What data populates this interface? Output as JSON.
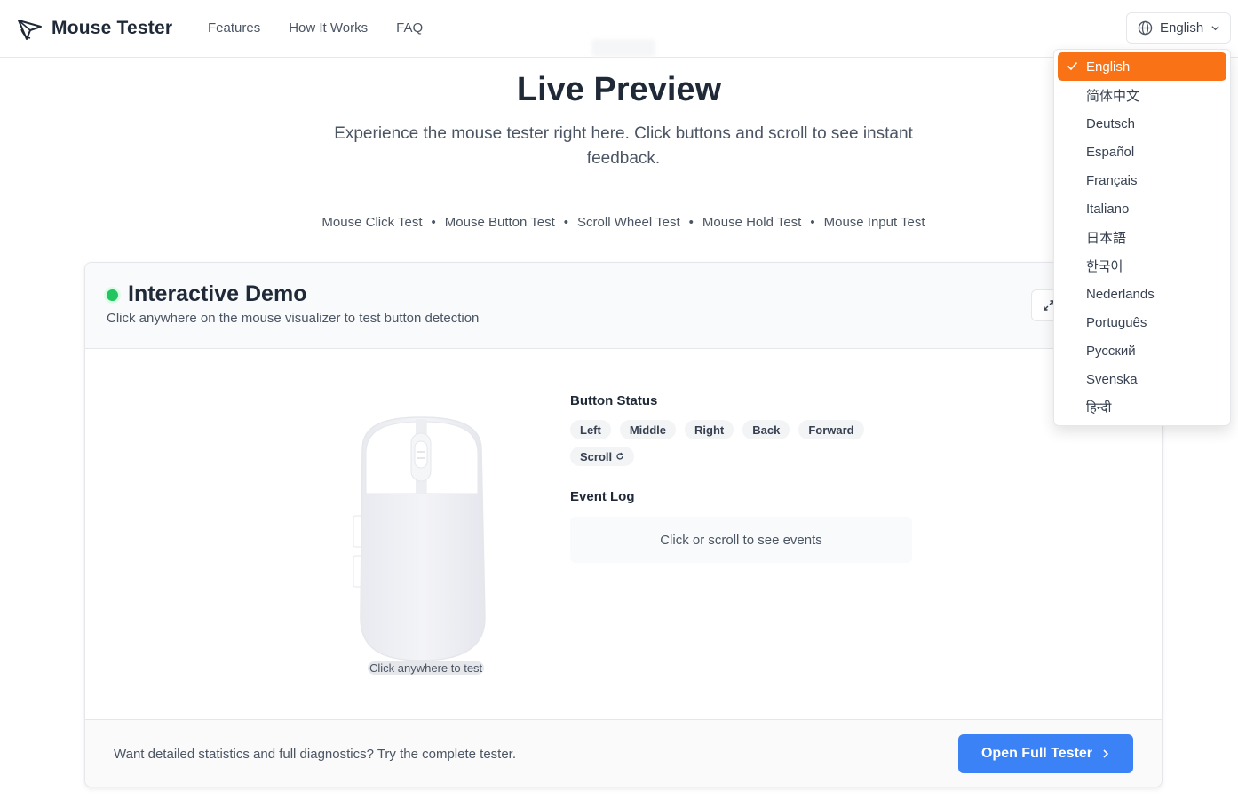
{
  "header": {
    "brand": "Mouse Tester",
    "nav": [
      "Features",
      "How It Works",
      "FAQ"
    ],
    "language_current": "English"
  },
  "hero": {
    "title": "Live Preview",
    "subtitle": "Experience the mouse tester right here. Click buttons and scroll to see instant feedback.",
    "tests": [
      "Mouse Click Test",
      "Mouse Button Test",
      "Scroll Wheel Test",
      "Mouse Hold Test",
      "Mouse Input Test"
    ],
    "separator": "•"
  },
  "demo": {
    "title": "Interactive Demo",
    "subtitle": "Click anywhere on the mouse visualizer to test button detection",
    "mouse_caption": "Click anywhere to test",
    "button_status_label": "Button Status",
    "buttons": [
      "Left",
      "Middle",
      "Right",
      "Back",
      "Forward",
      "Scroll"
    ],
    "event_log_label": "Event Log",
    "event_log_placeholder": "Click or scroll to see events",
    "footer_text": "Want detailed statistics and full diagnostics? Try the complete tester.",
    "open_button": "Open Full Tester"
  },
  "language_menu": {
    "selected": "English",
    "options": [
      "English",
      "简体中文",
      "Deutsch",
      "Español",
      "Français",
      "Italiano",
      "日本語",
      "한국어",
      "Nederlands",
      "Português",
      "Русский",
      "Svenska",
      "हिन्दी"
    ]
  },
  "colors": {
    "accent_orange": "#f97316",
    "primary_blue": "#3b82f6",
    "live_green": "#22c55e"
  },
  "icons": {
    "brand": "cursor-arrow-icon",
    "language": "globe-icon",
    "dropdown": "chevron-down-icon",
    "expand": "expand-icon",
    "selected": "check-icon",
    "open": "chevron-right-icon",
    "scroll": "refresh-icon"
  }
}
